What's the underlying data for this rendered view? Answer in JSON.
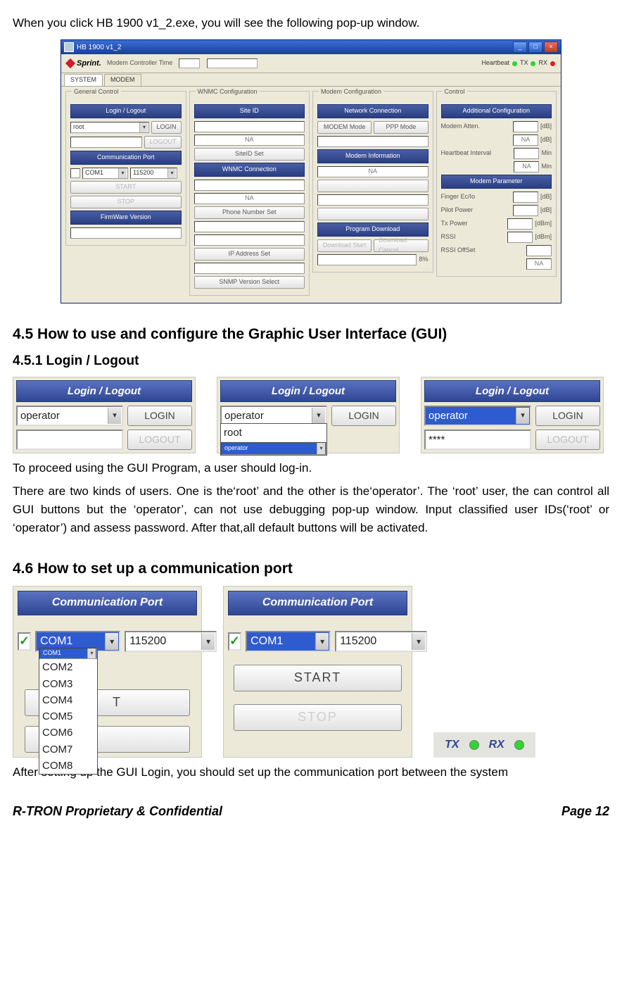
{
  "intro": "When you click HB 1900 v1_2.exe, you will see the following pop-up window.",
  "app": {
    "title": "HB 1900 v1_2",
    "brand": "Sprint.",
    "modemControllerTime": "Modem Controller Time",
    "heartbeat": "Heartbeat",
    "tx": "TX",
    "rx": "RX",
    "tabs": {
      "system": "SYSTEM",
      "modem": "MODEM"
    },
    "groups": {
      "general": "General Control",
      "wnmc": "WNMC Configuration",
      "modemcfg": "Modem Configuration",
      "control": "Control"
    },
    "headers": {
      "login": "Login / Logout",
      "commport": "Communication Port",
      "fw": "FirmWare Version",
      "siteid": "Site ID",
      "wnmcconn": "WNMC Connection",
      "netconn": "Network Connection",
      "modeminfo": "Modem Information",
      "progdl": "Program Download",
      "addcfg": "Additional Configuration",
      "modemparam": "Modem Parameter"
    },
    "buttons": {
      "login": "LOGIN",
      "logout": "LOGOUT",
      "start": "START",
      "stop": "STOP",
      "siteidset": "SiteID Set",
      "phoneset": "Phone Number Set",
      "ipset": "IP Address Set",
      "snmpsel": "SNMP Version Select",
      "modemmode": "MODEM Mode",
      "pppmode": "PPP Mode",
      "dlstart": "Download Start",
      "dlcancel": "Download Cancel"
    },
    "labels": {
      "root": "root",
      "com1": "COM1",
      "baud": "115200",
      "na": "NA",
      "modematten": "Modem Atten.",
      "hbinterval": "Heartbeat Interval",
      "fingerecio": "Finger Ec/Io",
      "pilotpower": "Pilot Power",
      "txpower": "Tx Power",
      "rssi": "RSSI",
      "rssioffset": "RSSI OffSet",
      "db": "[dB]",
      "dbm": "[dBm]",
      "min": "Min",
      "progress": "8%"
    }
  },
  "sec45": "4.5 How to use and configure the Graphic User Interface (GUI)",
  "sec451": "4.5.1 Login / Logout",
  "login_panels": {
    "header": "Login / Logout",
    "login": "LOGIN",
    "logout": "LOGOUT",
    "operator": "operator",
    "root": "root",
    "stars": "****"
  },
  "login_text": {
    "p1": "To proceed using the GUI Program, a user should log-in.",
    "p2": "There are two kinds of users. One is the‘root’ and the other is the‘operator’. The ‘root’ user, the can control all GUI buttons but the ‘operator’, can not use debugging pop-up window. Input classified user IDs(‘root’ or ‘operator’) and assess password. After that,all default buttons will be activated."
  },
  "sec46": "4.6 How to set up a communication port",
  "commport": {
    "header": "Communication Port",
    "com1": "COM1",
    "baud": "115200",
    "start": "START",
    "stop": "STOP",
    "coms": [
      "COM1",
      "COM2",
      "COM3",
      "COM4",
      "COM5",
      "COM6",
      "COM7",
      "COM8"
    ],
    "tx": "TX",
    "rx": "RX"
  },
  "after_cp": "After setting up the GUI Login, you should set up the communication port between the system",
  "footer": {
    "left": "R-TRON Proprietary & Confidential",
    "right": "Page 12"
  }
}
